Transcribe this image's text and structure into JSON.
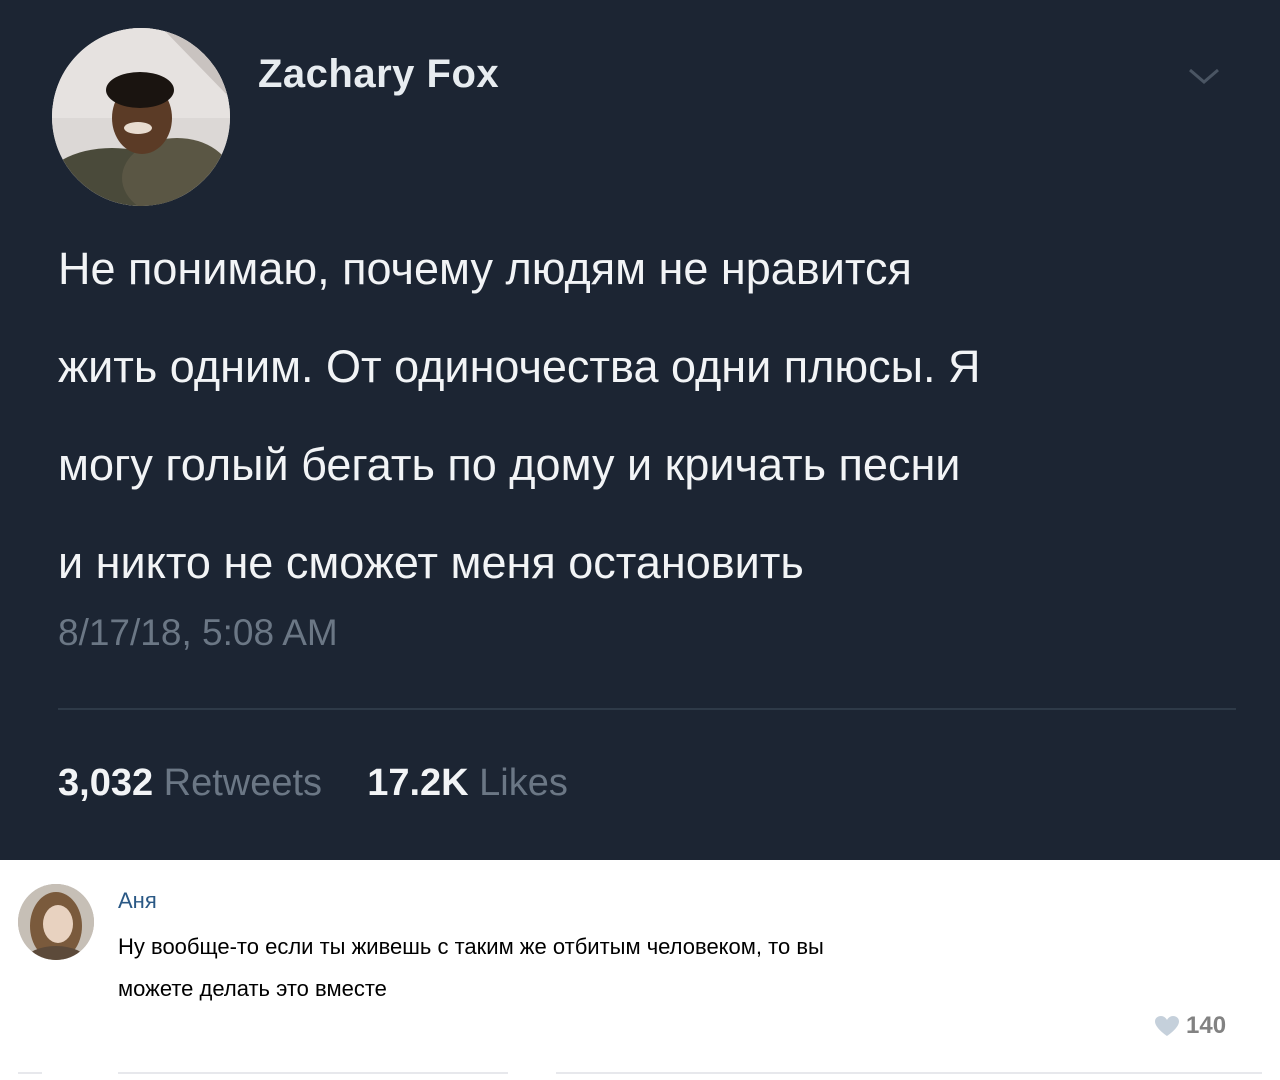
{
  "tweet": {
    "author": "Zachary Fox",
    "text_lines": [
      "Не понимаю, почему людям не нравится",
      "жить одним. От одиночества одни плюсы. Я",
      "могу голый бегать по дому и кричать песни",
      "и никто не сможет меня остановить"
    ],
    "timestamp": "8/17/18, 5:08 AM",
    "retweets_count": "3,032",
    "retweets_label": "Retweets",
    "likes_count": "17.2K",
    "likes_label": "Likes",
    "icons": {
      "avatar": "avatar-photo",
      "menu": "chevron-down-icon"
    },
    "colors": {
      "background": "#1c2533",
      "text": "#f2f4f6",
      "muted": "#6b7785"
    }
  },
  "comment": {
    "author": "Аня",
    "text_lines": [
      "Ну вообще-то если ты живешь с таким же отбитым человеком, то вы",
      "можете делать это вместе"
    ],
    "likes": "140",
    "icons": {
      "avatar": "avatar-photo",
      "like": "heart-icon"
    },
    "colors": {
      "name": "#2a5885",
      "likes": "#828282"
    }
  }
}
